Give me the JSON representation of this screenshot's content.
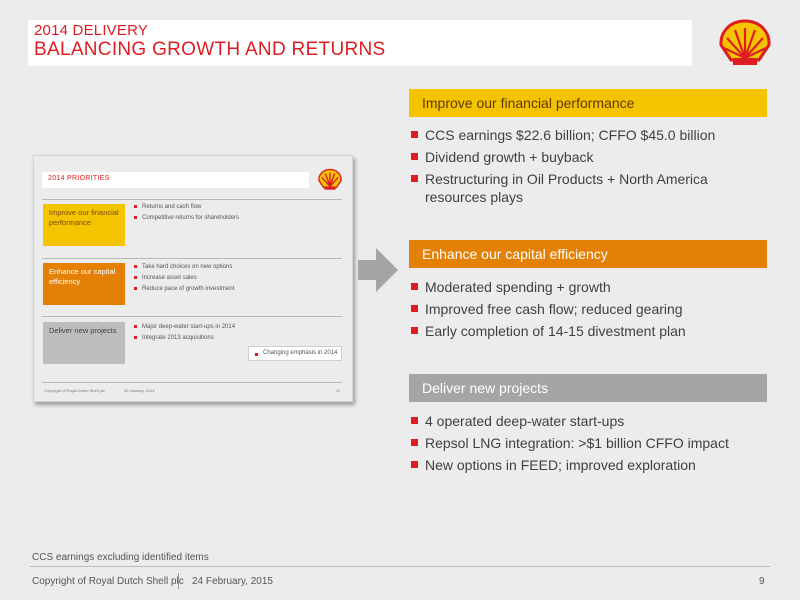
{
  "header": {
    "line1": "2014 DELIVERY",
    "line2": "BALANCING GROWTH AND RETURNS"
  },
  "thumbnail": {
    "title": "2014 PRIORITIES",
    "rows": [
      {
        "label": "Improve our financial performance",
        "bullets": [
          "Returns and cash flow",
          "Competitive returns for shareholders"
        ]
      },
      {
        "label": "Enhance our capital efficiency",
        "bullets": [
          "Take hard choices on new options",
          "Increase asset sales",
          "Reduce pace of growth investment"
        ]
      },
      {
        "label": "Deliver new projects",
        "bullets": [
          "Major deep-water start-ups in 2014",
          "Integrate 2013 acquisitions"
        ]
      }
    ],
    "tag": "Changing emphasis in 2014",
    "footer_copy": "Copyright of Royal Dutch Shell plc",
    "footer_date": "30 January, 2014",
    "footer_page": "11"
  },
  "sections": [
    {
      "heading": "Improve our financial performance",
      "bullets": [
        "CCS earnings $22.6 billion; CFFO $45.0 billion",
        "Dividend growth + buyback",
        "Restructuring in Oil Products + North America resources plays"
      ]
    },
    {
      "heading": "Enhance our capital efficiency",
      "bullets": [
        "Moderated spending + growth",
        "Improved free cash flow; reduced gearing",
        "Early completion of 14-15 divestment plan"
      ]
    },
    {
      "heading": "Deliver new projects",
      "bullets": [
        "4 operated deep-water start-ups",
        "Repsol LNG integration: >$1 billion CFFO impact",
        "New options in FEED; improved exploration"
      ]
    }
  ],
  "footer": {
    "footnote": "CCS earnings excluding identified items",
    "copyright": "Copyright of Royal Dutch Shell plc",
    "date": "24 February, 2015",
    "page": "9"
  },
  "colors": {
    "shell_red": "#dd1d21",
    "shell_yellow": "#f5c400",
    "orange": "#e58006",
    "grey": "#a5a5a5"
  }
}
